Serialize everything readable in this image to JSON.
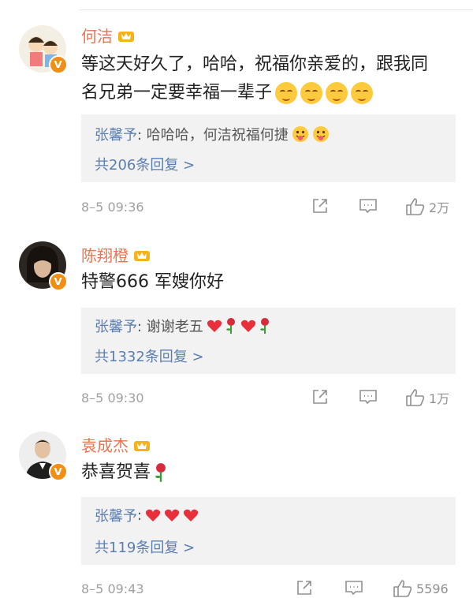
{
  "comments": [
    {
      "name": "何洁",
      "text": "等这天好久了，哈哈，祝福你亲爱的，跟我同名兄弟一定要幸福一辈子",
      "reply_author": "张馨予",
      "reply_text": ": 哈哈哈，何洁祝福何捷",
      "reply_count": "共206条回复 >",
      "time": "8–5 09:36",
      "likes": "2万"
    },
    {
      "name": "陈翔橙",
      "text": "特警666 军嫂你好",
      "reply_author": "张馨予",
      "reply_text": ": 谢谢老五",
      "reply_count": "共1332条回复 >",
      "time": "8–5 09:30",
      "likes": "1万"
    },
    {
      "name": "袁成杰",
      "text": "恭喜贺喜",
      "reply_author": "张馨予",
      "reply_text": ":",
      "reply_count": "共119条回复 >",
      "time": "8–5 09:43",
      "likes": "5596"
    }
  ],
  "icons": {
    "verified": "v-badge-icon",
    "crown": "vip-crown-icon",
    "share": "share-icon",
    "comment": "comment-icon",
    "like": "thumbs-up-icon"
  },
  "colors": {
    "name": "#eb7350",
    "link": "#5b7eb1",
    "verified_badge": "#f18e14",
    "reply_bg": "#f2f2f2"
  }
}
